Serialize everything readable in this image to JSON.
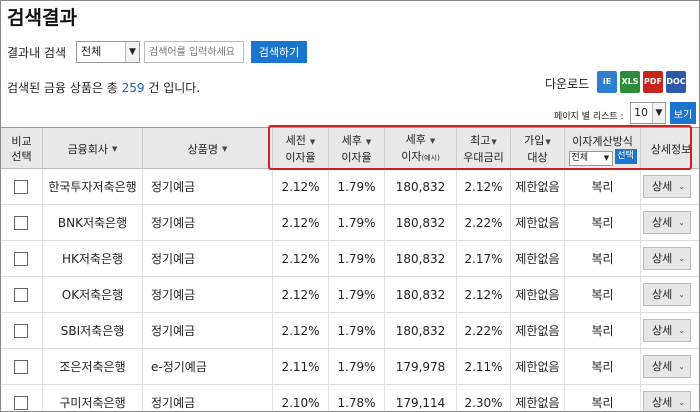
{
  "page": {
    "title": "검색결과"
  },
  "search": {
    "label": "결과내 검색",
    "scope_selected": "전체",
    "placeholder": "검색어를 입력하세요",
    "button": "검색하기"
  },
  "summary": {
    "prefix": "검색된 금융 상품은 총",
    "count": "259",
    "suffix": "건 입니다."
  },
  "download": {
    "label": "다운로드",
    "formats": [
      "IE",
      "XLS",
      "PDF",
      "DOC"
    ]
  },
  "pagesize": {
    "label": "페이지 별 리스트 :",
    "value": "10",
    "button": "보기"
  },
  "table": {
    "headers": {
      "compare": [
        "비교",
        "선택"
      ],
      "company": "금융회사",
      "product": "상품명",
      "pre_tax": [
        "세전",
        "이자율"
      ],
      "post_tax": [
        "세후",
        "이자율"
      ],
      "post_interest": [
        "세후",
        "이자",
        "(예시)"
      ],
      "max_rate": [
        "최고",
        "우대금리"
      ],
      "join": [
        "가입",
        "대상"
      ],
      "calc": {
        "label": "이자계산방식",
        "selected": "전체",
        "button": "선택"
      },
      "detail": "상세정보"
    },
    "sort_arrow": "▼",
    "detail_label": "상세",
    "detail_chevron": "⌄",
    "rows": [
      {
        "company": "한국투자저축은행",
        "product": "정기예금",
        "pre": "2.12%",
        "post": "1.79%",
        "interest": "180,832",
        "max": "2.12%",
        "target": "제한없음",
        "calc": "복리"
      },
      {
        "company": "BNK저축은행",
        "product": "정기예금",
        "pre": "2.12%",
        "post": "1.79%",
        "interest": "180,832",
        "max": "2.22%",
        "target": "제한없음",
        "calc": "복리"
      },
      {
        "company": "HK저축은행",
        "product": "정기예금",
        "pre": "2.12%",
        "post": "1.79%",
        "interest": "180,832",
        "max": "2.17%",
        "target": "제한없음",
        "calc": "복리"
      },
      {
        "company": "OK저축은행",
        "product": "정기예금",
        "pre": "2.12%",
        "post": "1.79%",
        "interest": "180,832",
        "max": "2.12%",
        "target": "제한없음",
        "calc": "복리"
      },
      {
        "company": "SBI저축은행",
        "product": "정기예금",
        "pre": "2.12%",
        "post": "1.79%",
        "interest": "180,832",
        "max": "2.22%",
        "target": "제한없음",
        "calc": "복리"
      },
      {
        "company": "조은저축은행",
        "product": "e-정기예금",
        "pre": "2.11%",
        "post": "1.79%",
        "interest": "179,978",
        "max": "2.11%",
        "target": "제한없음",
        "calc": "복리"
      },
      {
        "company": "구미저축은행",
        "product": "정기예금",
        "pre": "2.10%",
        "post": "1.78%",
        "interest": "179,114",
        "max": "2.30%",
        "target": "제한없음",
        "calc": "복리"
      }
    ]
  },
  "colors": {
    "accent": "#1a75cf",
    "highlight": "#d21f1f",
    "count": "#1a5fb4"
  }
}
